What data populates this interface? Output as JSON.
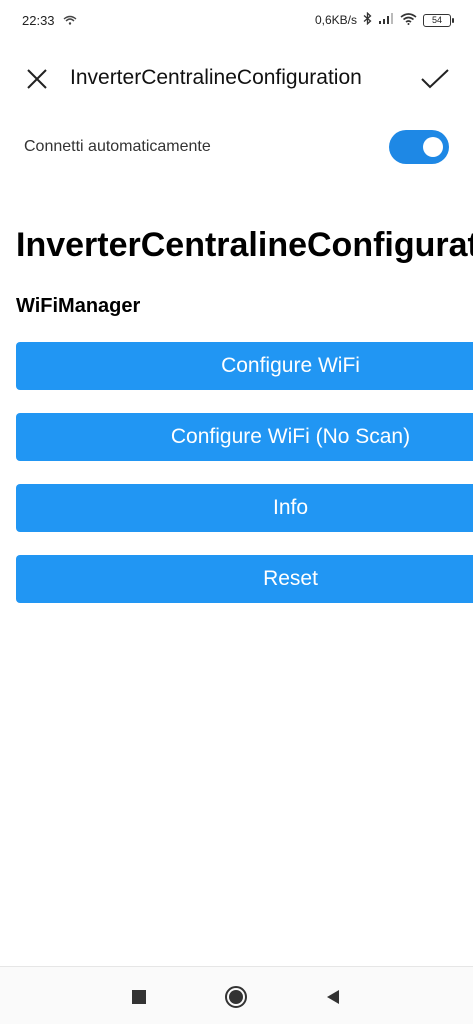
{
  "status_bar": {
    "time": "22:33",
    "network_speed": "0,6KB/s",
    "battery_level": "54",
    "icons": [
      "data-sync-icon",
      "bluetooth-icon",
      "signal-icon",
      "wifi-icon",
      "battery-icon"
    ]
  },
  "header": {
    "title": "InverterCentralineConfiguration",
    "close_icon": "close-icon",
    "confirm_icon": "check-icon"
  },
  "auto_connect": {
    "label": "Connetti automaticamente",
    "enabled": true
  },
  "page": {
    "title": "InverterCentralineConfiguration",
    "section": "WiFiManager"
  },
  "buttons": [
    {
      "label": "Configure WiFi"
    },
    {
      "label": "Configure WiFi (No Scan)"
    },
    {
      "label": "Info"
    },
    {
      "label": "Reset"
    }
  ],
  "nav": {
    "icons": [
      "recent-apps-icon",
      "home-icon",
      "back-icon"
    ]
  },
  "colors": {
    "accent": "#2196f3",
    "toggle": "#1e88e5"
  }
}
